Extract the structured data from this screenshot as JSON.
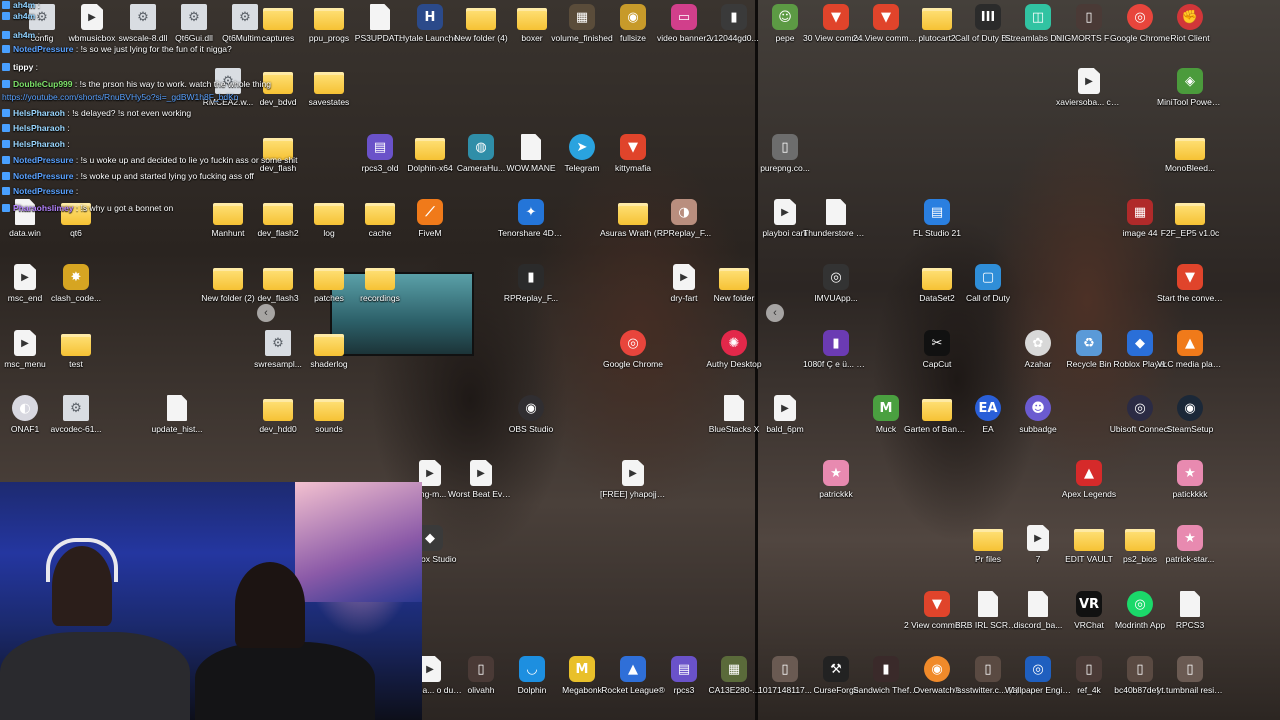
{
  "chat": {
    "lines": [
      {
        "user": "ah4m",
        "sep": " :",
        "msg": "",
        "color": "#8fd1ff"
      },
      {
        "user": "ah4m",
        "sep": " :",
        "msg": "",
        "color": "#8fd1ff"
      },
      {
        "user": "ah4m",
        "sep": " :",
        "msg": "",
        "color": "#8fd1ff"
      },
      {
        "user": "NotedPressure",
        "sep": " : ",
        "msg": "!s so we just lying for the fun of it nigga?",
        "color": "#5aa2ff"
      },
      {
        "user": "tippy",
        "sep": " : ",
        "msg": "",
        "color": "#ffffff"
      },
      {
        "user": "DoubleCup999",
        "sep": " : ",
        "msg": "!s the prson his way to work. watch the whole thing",
        "color": "#7ee36a"
      },
      {
        "user": "",
        "sep": "",
        "msg": "https://youtube.com/shorts/RnuBVHy5o?si=_gdBW1h8F_bdKn",
        "color": "#5aa2ff",
        "link": true
      },
      {
        "user": "HelsPharaoh",
        "sep": " : ",
        "msg": "!s delayed? !s not even working",
        "color": "#9ad7ff"
      },
      {
        "user": "HelsPharaoh",
        "sep": " : ",
        "msg": "",
        "color": "#9ad7ff"
      },
      {
        "user": "HelsPharaoh",
        "sep": " : ",
        "msg": "",
        "color": "#9ad7ff"
      },
      {
        "user": "NotedPressure",
        "sep": " : ",
        "msg": "!s u woke up and decided to lie yo fuckin ass or some shit",
        "color": "#5aa2ff"
      },
      {
        "user": "NotedPressure",
        "sep": " : ",
        "msg": "!s woke up and started lying yo fucking ass off",
        "color": "#5aa2ff"
      },
      {
        "user": "NotedPressure",
        "sep": " : ",
        "msg": "",
        "color": "#5aa2ff"
      },
      {
        "user": "Pharaohslimey",
        "sep": " : ",
        "msg": "!s why u got a bonnet on",
        "color": "#b583ff"
      }
    ]
  },
  "left_icons": [
    {
      "label": "config",
      "kind": "gear"
    },
    {
      "label": "wbmusicbox",
      "kind": "video"
    },
    {
      "label": "swscale-8.dll",
      "kind": "gear"
    },
    {
      "label": "Qt6Gui.dll",
      "kind": "gear"
    },
    {
      "label": "Qt6Multim...",
      "kind": "gear"
    },
    {
      "label": "captures",
      "kind": "folder"
    },
    {
      "label": "ppu_progs",
      "kind": "folder"
    },
    {
      "label": "PS3UPDAT...",
      "kind": "file"
    },
    {
      "label": "Hytale Launcher",
      "kind": "app",
      "bg": "#2b4a8a",
      "glyph": "H"
    },
    {
      "label": "New folder (4)",
      "kind": "folder"
    },
    {
      "label": "boxer",
      "kind": "folder"
    },
    {
      "label": "volume_finished",
      "kind": "app",
      "bg": "#5a4c3a",
      "glyph": "▦"
    },
    {
      "label": "fullsize",
      "kind": "app",
      "bg": "#c79a2a",
      "glyph": "◉"
    },
    {
      "label": "video banner2",
      "kind": "app",
      "bg": "#d13f8b",
      "glyph": "▭"
    },
    {
      "label": "v12044gd0...",
      "kind": "app",
      "bg": "#3a3a3a",
      "glyph": "▮"
    },
    {
      "label": "RMCEA2.w...",
      "kind": "gear"
    },
    {
      "label": "dev_bdvd",
      "kind": "folder"
    },
    {
      "label": "savestates",
      "kind": "folder"
    },
    {
      "label": "dev_flash",
      "kind": "folder"
    },
    {
      "label": "rpcs3_old",
      "kind": "app",
      "bg": "#6a52c9",
      "glyph": "▤"
    },
    {
      "label": "Dolphin-x64",
      "kind": "folder"
    },
    {
      "label": "CameraHu...",
      "kind": "app",
      "bg": "#2f8ea8",
      "glyph": "◍"
    },
    {
      "label": "WOW.MANE",
      "kind": "file"
    },
    {
      "label": "Telegram",
      "kind": "app",
      "bg": "#2aa3df",
      "glyph": "➤",
      "round": true
    },
    {
      "label": "kittymafia",
      "kind": "app",
      "bg": "#e0442b",
      "glyph": "▼"
    },
    {
      "label": "data.win",
      "kind": "file"
    },
    {
      "label": "qt6",
      "kind": "folder"
    },
    {
      "label": "Manhunt",
      "kind": "folder"
    },
    {
      "label": "dev_flash2",
      "kind": "folder"
    },
    {
      "label": "log",
      "kind": "folder"
    },
    {
      "label": "cache",
      "kind": "folder"
    },
    {
      "label": "FiveM",
      "kind": "app",
      "bg": "#f07a1a",
      "glyph": "⟋"
    },
    {
      "label": "Tenorshare 4DDiG",
      "kind": "app",
      "bg": "#2475d8",
      "glyph": "✦"
    },
    {
      "label": "Asuras Wrath (USA) (En,Ja...",
      "kind": "folder"
    },
    {
      "label": "RPReplay_F...",
      "kind": "app",
      "bg": "#b98e7e",
      "glyph": "◑"
    },
    {
      "label": "msc_end",
      "kind": "video"
    },
    {
      "label": "clash_code...",
      "kind": "app",
      "bg": "#d6a522",
      "glyph": "✸"
    },
    {
      "label": "New folder (2)",
      "kind": "folder"
    },
    {
      "label": "dev_flash3",
      "kind": "folder"
    },
    {
      "label": "patches",
      "kind": "folder"
    },
    {
      "label": "recordings",
      "kind": "folder"
    },
    {
      "label": "RPReplay_F...",
      "kind": "app",
      "bg": "#2b2b2b",
      "glyph": "▮"
    },
    {
      "label": "dry-fart",
      "kind": "video"
    },
    {
      "label": "New folder",
      "kind": "folder"
    },
    {
      "label": "msc_menu",
      "kind": "video"
    },
    {
      "label": "test",
      "kind": "folder"
    },
    {
      "label": "swresampl...",
      "kind": "gear"
    },
    {
      "label": "shaderlog",
      "kind": "folder"
    },
    {
      "label": "Google Chrome",
      "kind": "app",
      "bg": "#e8453c",
      "glyph": "◎",
      "round": true
    },
    {
      "label": "Authy Desktop",
      "kind": "app",
      "bg": "#e3284a",
      "glyph": "✺",
      "round": true
    },
    {
      "label": "ONAF1",
      "kind": "app",
      "bg": "#d8d8e0",
      "glyph": "◐",
      "round": true
    },
    {
      "label": "avcodec-61...",
      "kind": "gear"
    },
    {
      "label": "update_hist...",
      "kind": "file"
    },
    {
      "label": "dev_hdd0",
      "kind": "folder"
    },
    {
      "label": "sounds",
      "kind": "folder"
    },
    {
      "label": "OBS Studio",
      "kind": "app",
      "bg": "#302e31",
      "glyph": "◉",
      "round": true
    },
    {
      "label": "BlueStacks X",
      "kind": "file"
    },
    {
      "label": "king-m...",
      "kind": "video"
    },
    {
      "label": "Worst Beat Ever Creat...",
      "kind": "video"
    },
    {
      "label": "[FREE] yhapojj x ...",
      "kind": "video"
    },
    {
      "label": "Roblox Studio",
      "kind": "app",
      "bg": "#3a3a3a",
      "glyph": "◆"
    },
    {
      "label": "xersoba... o dubs ...",
      "kind": "video"
    },
    {
      "label": "olivahh",
      "kind": "app",
      "bg": "#4a3a36",
      "glyph": "▯"
    },
    {
      "label": "Dolphin",
      "kind": "app",
      "bg": "#1d8fe0",
      "glyph": "◡"
    },
    {
      "label": "Megabonk",
      "kind": "app",
      "bg": "#e9c02a",
      "glyph": "M"
    },
    {
      "label": "Rocket League®",
      "kind": "app",
      "bg": "#2f6fd8",
      "glyph": "▲"
    },
    {
      "label": "rpcs3",
      "kind": "app",
      "bg": "#6a52c9",
      "glyph": "▤"
    },
    {
      "label": "CA13E280-...",
      "kind": "app",
      "bg": "#5a6a3a",
      "glyph": "▦"
    }
  ],
  "right_icons": [
    {
      "label": "pepe",
      "kind": "app",
      "bg": "#5c9a44",
      "glyph": "☺"
    },
    {
      "label": "30 View comments",
      "kind": "app",
      "bg": "#e0442b",
      "glyph": "▼"
    },
    {
      "label": "24 View comments",
      "kind": "app",
      "bg": "#e0442b",
      "glyph": "▼"
    },
    {
      "label": "plutocart2",
      "kind": "folder"
    },
    {
      "label": "Call of Duty Black Ops III",
      "kind": "app",
      "bg": "#2b2b2b",
      "glyph": "III"
    },
    {
      "label": "Streamlabs Desktop",
      "kind": "app",
      "bg": "#31c3a2",
      "glyph": "◫"
    },
    {
      "label": "NIGMORTS FREESTYLE...",
      "kind": "app",
      "bg": "#4a3a36",
      "glyph": "▯"
    },
    {
      "label": "Google Chrome",
      "kind": "app",
      "bg": "#e8453c",
      "glyph": "◎",
      "round": true
    },
    {
      "label": "Riot Client",
      "kind": "app",
      "bg": "#d13639",
      "glyph": "✊",
      "round": true
    },
    {
      "label": "xaviersoba... crisp dubs ...",
      "kind": "video"
    },
    {
      "label": "MiniTool Power Data ...",
      "kind": "app",
      "bg": "#4b9b3c",
      "glyph": "◈"
    },
    {
      "label": "purepng.co...",
      "kind": "app",
      "bg": "#6d6d6d",
      "glyph": "▯"
    },
    {
      "label": "MonoBleed...",
      "kind": "folder"
    },
    {
      "label": "playboi carti",
      "kind": "video"
    },
    {
      "label": "Thunderstore Mod Mana...",
      "kind": "file"
    },
    {
      "label": "FL Studio 21",
      "kind": "app",
      "bg": "#2a7fe0",
      "glyph": "▤"
    },
    {
      "label": "image 44",
      "kind": "app",
      "bg": "#b02a2a",
      "glyph": "▦"
    },
    {
      "label": "F2F_EP5 v1.0c",
      "kind": "folder"
    },
    {
      "label": "IMVUApp...",
      "kind": "app",
      "bg": "#333333",
      "glyph": "◎"
    },
    {
      "label": "DataSet2",
      "kind": "folder"
    },
    {
      "label": "Call of Duty",
      "kind": "app",
      "bg": "#2f8ed8",
      "glyph": "▢"
    },
    {
      "label": "Start the conversation",
      "kind": "app",
      "bg": "#e0442b",
      "glyph": "▼"
    },
    {
      "label": "1080f Ç e ü... Facebook P...",
      "kind": "app",
      "bg": "#6b3bb3",
      "glyph": "▮"
    },
    {
      "label": "CapCut",
      "kind": "app",
      "bg": "#111111",
      "glyph": "✂"
    },
    {
      "label": "Azahar",
      "kind": "app",
      "bg": "#d8d8d8",
      "glyph": "✿",
      "round": true
    },
    {
      "label": "Recycle Bin",
      "kind": "app",
      "bg": "#5a9ad8",
      "glyph": "♻"
    },
    {
      "label": "Roblox Player",
      "kind": "app",
      "bg": "#2a6fd8",
      "glyph": "◆"
    },
    {
      "label": "VLC media player",
      "kind": "app",
      "bg": "#f07a1a",
      "glyph": "▲"
    },
    {
      "label": "bald_6pm",
      "kind": "video"
    },
    {
      "label": "Muck",
      "kind": "app",
      "bg": "#4aa040",
      "glyph": "M"
    },
    {
      "label": "Garten of Banban",
      "kind": "folder"
    },
    {
      "label": "EA",
      "kind": "app",
      "bg": "#2a5fd8",
      "glyph": "EA",
      "round": true
    },
    {
      "label": "subbadge",
      "kind": "app",
      "bg": "#6b5bd0",
      "glyph": "☻",
      "round": true
    },
    {
      "label": "Ubisoft Connect",
      "kind": "app",
      "bg": "#2b2b44",
      "glyph": "◎",
      "round": true
    },
    {
      "label": "SteamSetup",
      "kind": "app",
      "bg": "#1b2838",
      "glyph": "◉",
      "round": true
    },
    {
      "label": "patrickkk",
      "kind": "app",
      "bg": "#e88ab0",
      "glyph": "★"
    },
    {
      "label": "Apex Legends",
      "kind": "app",
      "bg": "#d62a2a",
      "glyph": "▲"
    },
    {
      "label": "patickkkk",
      "kind": "app",
      "bg": "#e88ab0",
      "glyph": "★"
    },
    {
      "label": "Pr files",
      "kind": "folder"
    },
    {
      "label": "7",
      "kind": "video"
    },
    {
      "label": "EDIT VAULT",
      "kind": "folder"
    },
    {
      "label": "ps2_bios",
      "kind": "folder"
    },
    {
      "label": "patrick-star...",
      "kind": "app",
      "bg": "#e88ab0",
      "glyph": "★"
    },
    {
      "label": "2 View comments",
      "kind": "app",
      "bg": "#e0442b",
      "glyph": "▼"
    },
    {
      "label": "BRB IRL SCREE...",
      "kind": "file"
    },
    {
      "label": "discord_ba...",
      "kind": "file"
    },
    {
      "label": "VRChat",
      "kind": "app",
      "bg": "#111111",
      "glyph": "VR"
    },
    {
      "label": "Modrinth App",
      "kind": "app",
      "bg": "#1bd96a",
      "glyph": "◎",
      "round": true
    },
    {
      "label": "RPCS3",
      "kind": "file"
    },
    {
      "label": "1017148117...",
      "kind": "app",
      "bg": "#6a5a52",
      "glyph": "▯"
    },
    {
      "label": "CurseForge",
      "kind": "app",
      "bg": "#222222",
      "glyph": "⚒"
    },
    {
      "label": "Sandwich Theft Lead...",
      "kind": "app",
      "bg": "#3a2a2a",
      "glyph": "▮"
    },
    {
      "label": "Overwatch®",
      "kind": "app",
      "bg": "#f08a2a",
      "glyph": "◉",
      "round": true
    },
    {
      "label": "ssstwitter.c... (1)",
      "kind": "app",
      "bg": "#5a4a42",
      "glyph": "▯"
    },
    {
      "label": "Wallpaper Engine",
      "kind": "app",
      "bg": "#1f5fbf",
      "glyph": "◎"
    },
    {
      "label": "ref_4k",
      "kind": "app",
      "bg": "#4a3a36",
      "glyph": "▯"
    },
    {
      "label": "bc40b87def...",
      "kind": "app",
      "bg": "#5a4a42",
      "glyph": "▯"
    },
    {
      "label": "yt tumbnail resize",
      "kind": "app",
      "bg": "#6a5a52",
      "glyph": "▯"
    }
  ],
  "nav": {
    "prev": "‹",
    "next": "‹"
  }
}
